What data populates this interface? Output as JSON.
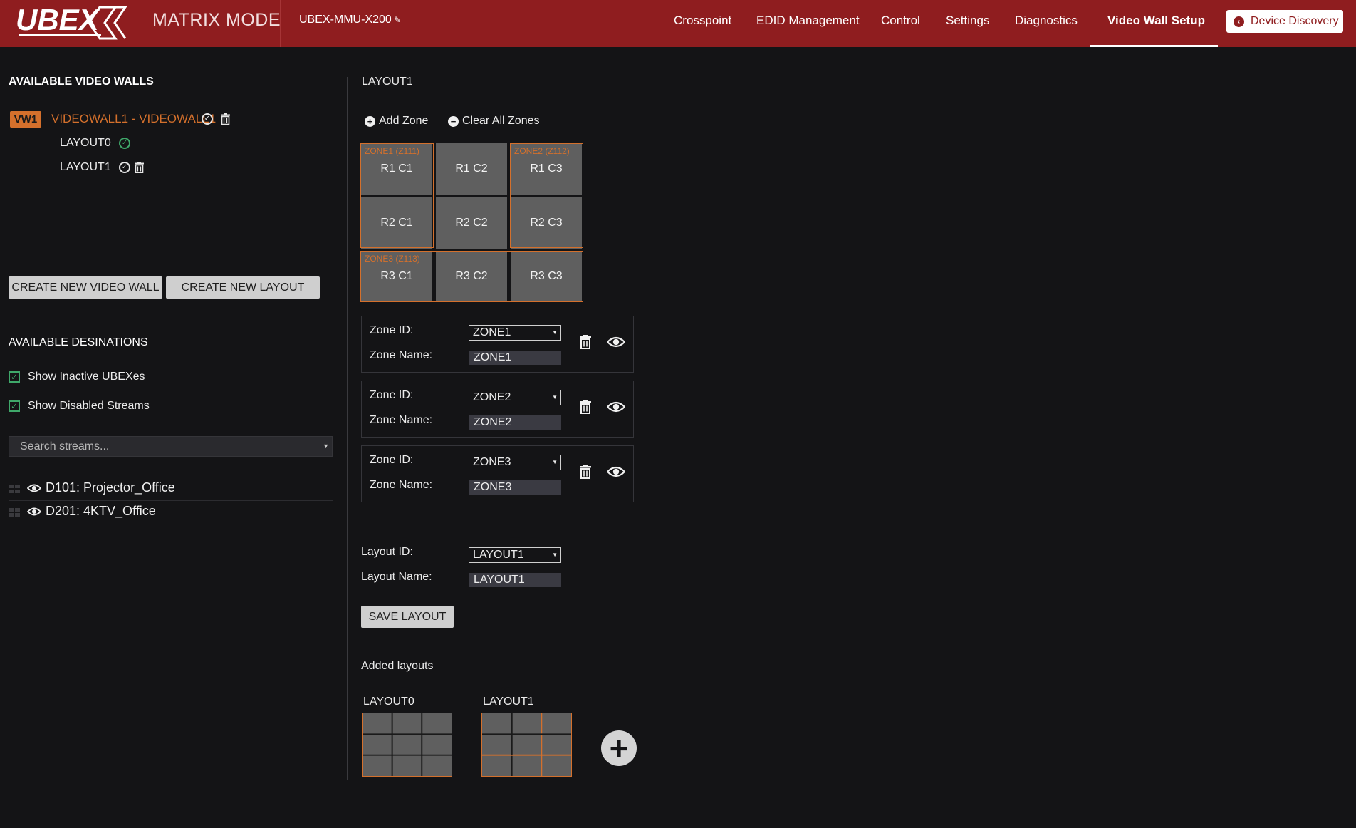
{
  "header": {
    "logo_text": "UBEX",
    "mode": "MATRIX MODE",
    "device_name": "UBEX-MMU-X200",
    "device_name_edit_icon": "pencil-icon",
    "nav": [
      "Crosspoint",
      "EDID Management",
      "Control",
      "Settings",
      "Diagnostics",
      "Video Wall Setup"
    ],
    "active_nav": "Video Wall Setup",
    "device_discovery": "Device Discovery"
  },
  "sidebar": {
    "video_walls_title": "AVAILABLE VIDEO WALLS",
    "videowall_tag": "VW1",
    "videowall_name": "VIDEOWALL1 - VIDEOWALL1",
    "layouts": [
      "LAYOUT0",
      "LAYOUT1"
    ],
    "create_wall": "CREATE NEW VIDEO WALL",
    "create_layout": "CREATE NEW LAYOUT",
    "destinations_title": "AVAILABLE DESINATIONS",
    "show_inactive": "Show Inactive UBEXes",
    "show_disabled": "Show Disabled Streams",
    "search_placeholder": "Search streams...",
    "destinations": [
      "D101: Projector_Office",
      "D201: 4KTV_Office"
    ]
  },
  "layout": {
    "title": "LAYOUT1",
    "add_zone": "Add Zone",
    "clear_zones": "Clear All Zones",
    "cells": [
      "R1 C1",
      "R1 C2",
      "R1 C3",
      "R2 C1",
      "R2 C2",
      "R2 C3",
      "R3 C1",
      "R3 C2",
      "R3 C3"
    ],
    "zone_tags": [
      "ZONE1 (Z111)",
      "ZONE2 (Z112)",
      "ZONE3 (Z113)"
    ],
    "zone_id_label": "Zone ID:",
    "zone_name_label": "Zone Name:",
    "zones": [
      {
        "id": "ZONE1",
        "name": "ZONE1"
      },
      {
        "id": "ZONE2",
        "name": "ZONE2"
      },
      {
        "id": "ZONE3",
        "name": "ZONE3"
      }
    ],
    "layout_id_label": "Layout ID:",
    "layout_id": "LAYOUT1",
    "layout_name_label": "Layout Name:",
    "layout_name": "LAYOUT1",
    "save": "SAVE LAYOUT",
    "added_title": "Added layouts",
    "added": [
      "LAYOUT0",
      "LAYOUT1"
    ]
  },
  "colors": {
    "header_bg": "#8f1d1f",
    "accent": "#d4702c",
    "check_green": "#3fa86a",
    "background": "#141416"
  }
}
